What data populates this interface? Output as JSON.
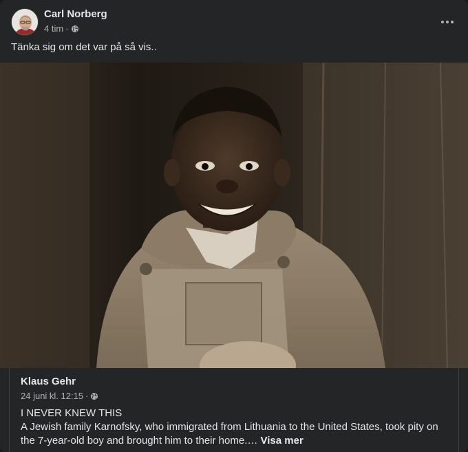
{
  "post": {
    "author": "Carl Norberg",
    "time": "4 tim",
    "dot": "·",
    "audience_icon": "globe-icon",
    "text": "Tänka sig om det var på så vis.."
  },
  "shared": {
    "author": "Klaus Gehr",
    "time": "24 juni kl. 12:15",
    "dot": "·",
    "audience_icon": "globe-icon",
    "line1": "I NEVER KNEW THIS",
    "body": "A Jewish family Karnofsky, who immigrated from Lithuania to the United States, took pity on the 7-year-old boy and brought him to their home.…",
    "see_more": "Visa mer"
  },
  "colors": {
    "background": "#18191a",
    "card": "#242526",
    "text_primary": "#e4e6eb",
    "text_secondary": "#b0b3b8"
  }
}
